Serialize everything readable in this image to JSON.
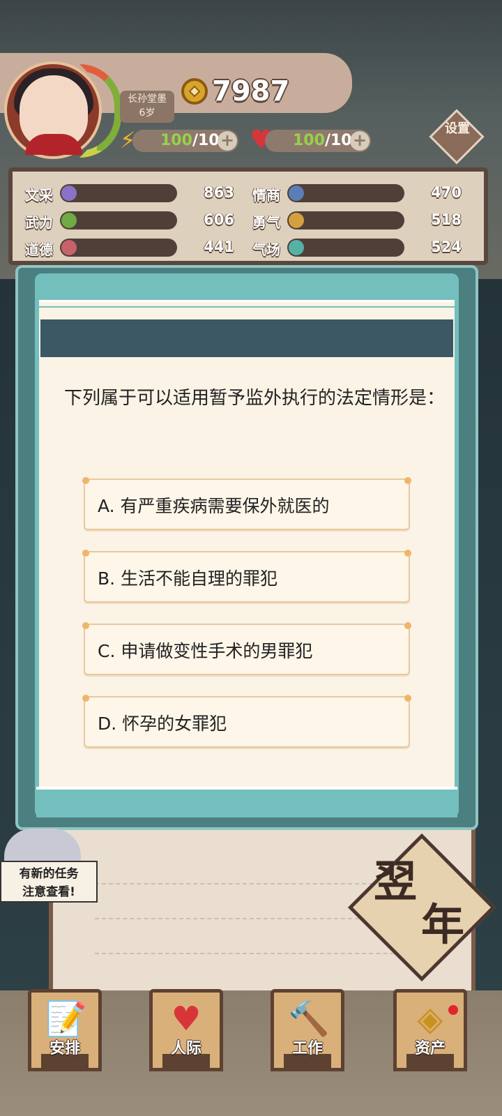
{
  "player": {
    "name": "长孙堂墨",
    "age": "6岁",
    "coins": "7987",
    "energy": {
      "current": "100",
      "max": "/100"
    },
    "health": {
      "current": "100",
      "max": "/100"
    }
  },
  "settings_label": "设置",
  "stats": [
    {
      "label": "文采",
      "value": "863",
      "color": "#8a72c6"
    },
    {
      "label": "情商",
      "value": "470",
      "color": "#5b7db8"
    },
    {
      "label": "武力",
      "value": "606",
      "color": "#6eab45"
    },
    {
      "label": "勇气",
      "value": "518",
      "color": "#d49f3e"
    },
    {
      "label": "道德",
      "value": "441",
      "color": "#c7626a"
    },
    {
      "label": "气场",
      "value": "524",
      "color": "#55b1a6"
    }
  ],
  "quiz": {
    "question": "下列属于可以适用暂予监外执行的法定情形是：",
    "options": [
      "A. 有严重疾病需要保外就医的",
      "B. 生活不能自理的罪犯",
      "C. 申请做变性手术的男罪犯",
      "D. 怀孕的女罪犯"
    ]
  },
  "task_notice": {
    "line1": "有新的任务",
    "line2": "注意查看!"
  },
  "next_year": {
    "char1": "翌",
    "char2": "年"
  },
  "nav": [
    {
      "label": "安排",
      "icon": "schedule-icon"
    },
    {
      "label": "人际",
      "icon": "heart-arrow-icon"
    },
    {
      "label": "工作",
      "icon": "hammer-icon"
    },
    {
      "label": "资产",
      "icon": "coin-icon"
    }
  ]
}
